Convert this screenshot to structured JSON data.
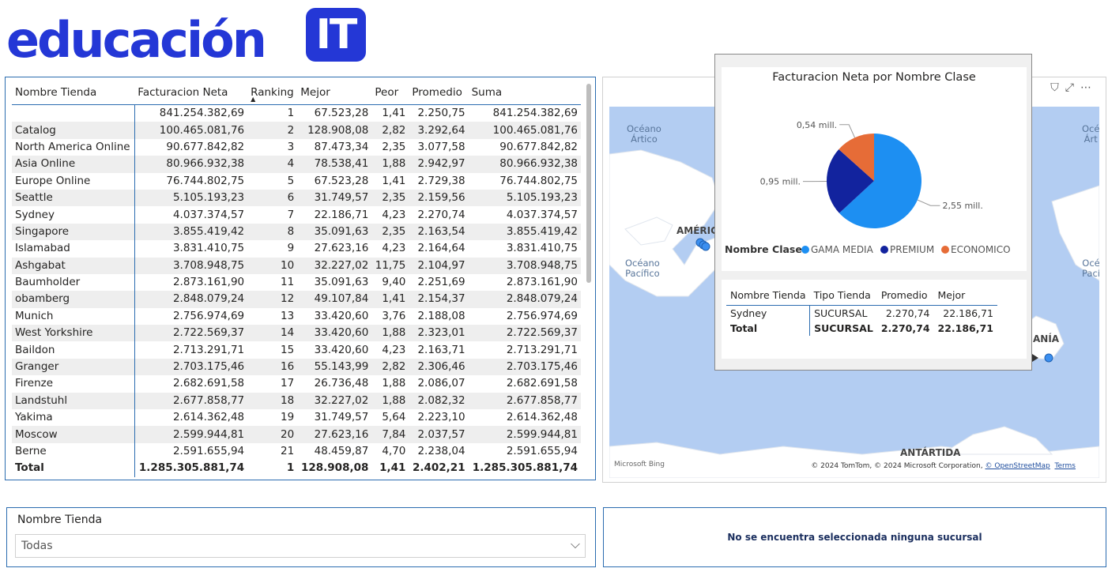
{
  "colors": {
    "brand_blue": "#2437d6",
    "gama_media": "#1d8ff2",
    "premium": "#12239e",
    "economico": "#e66c37"
  },
  "logo": {
    "text": "educación",
    "badge": "IT"
  },
  "table": {
    "headers": [
      "Nombre Tienda",
      "Facturacion Neta",
      "Ranking",
      "Mejor",
      "Peor",
      "Promedio",
      "Suma"
    ],
    "rows": [
      [
        "",
        "841.254.382,69",
        "1",
        "67.523,28",
        "1,41",
        "2.250,75",
        "841.254.382,69"
      ],
      [
        "Catalog",
        "100.465.081,76",
        "2",
        "128.908,08",
        "2,82",
        "3.292,64",
        "100.465.081,76"
      ],
      [
        "North America Online",
        "90.677.842,82",
        "3",
        "87.473,34",
        "2,35",
        "3.077,58",
        "90.677.842,82"
      ],
      [
        "Asia Online",
        "80.966.932,38",
        "4",
        "78.538,41",
        "1,88",
        "2.942,97",
        "80.966.932,38"
      ],
      [
        "Europe Online",
        "76.744.802,75",
        "5",
        "67.523,28",
        "1,41",
        "2.729,38",
        "76.744.802,75"
      ],
      [
        "Seattle",
        "5.105.193,23",
        "6",
        "31.749,57",
        "2,35",
        "2.159,56",
        "5.105.193,23"
      ],
      [
        "Sydney",
        "4.037.374,57",
        "7",
        "22.186,71",
        "4,23",
        "2.270,74",
        "4.037.374,57"
      ],
      [
        "Singapore",
        "3.855.419,42",
        "8",
        "35.091,63",
        "2,35",
        "2.163,54",
        "3.855.419,42"
      ],
      [
        "Islamabad",
        "3.831.410,75",
        "9",
        "27.623,16",
        "4,23",
        "2.164,64",
        "3.831.410,75"
      ],
      [
        "Ashgabat",
        "3.708.948,75",
        "10",
        "32.227,02",
        "11,75",
        "2.104,97",
        "3.708.948,75"
      ],
      [
        "Baumholder",
        "2.873.161,90",
        "11",
        "35.091,63",
        "9,40",
        "2.251,69",
        "2.873.161,90"
      ],
      [
        "obamberg",
        "2.848.079,24",
        "12",
        "49.107,84",
        "1,41",
        "2.154,37",
        "2.848.079,24"
      ],
      [
        "Munich",
        "2.756.974,69",
        "13",
        "33.420,60",
        "3,76",
        "2.188,08",
        "2.756.974,69"
      ],
      [
        "West Yorkshire",
        "2.722.569,37",
        "14",
        "33.420,60",
        "1,88",
        "2.323,01",
        "2.722.569,37"
      ],
      [
        "Baildon",
        "2.713.291,71",
        "15",
        "33.420,60",
        "4,23",
        "2.163,71",
        "2.713.291,71"
      ],
      [
        "Granger",
        "2.703.175,46",
        "16",
        "55.143,99",
        "2,82",
        "2.306,46",
        "2.703.175,46"
      ],
      [
        "Firenze",
        "2.682.691,58",
        "17",
        "26.736,48",
        "1,88",
        "2.086,07",
        "2.682.691,58"
      ],
      [
        "Landstuhl",
        "2.677.858,77",
        "18",
        "32.227,02",
        "1,88",
        "2.082,32",
        "2.677.858,77"
      ],
      [
        "Yakima",
        "2.614.362,48",
        "19",
        "31.749,57",
        "5,64",
        "2.223,10",
        "2.614.362,48"
      ],
      [
        "Moscow",
        "2.599.944,81",
        "20",
        "27.623,16",
        "7,84",
        "2.037,57",
        "2.599.944,81"
      ],
      [
        "Berne",
        "2.591.655,94",
        "21",
        "48.459,87",
        "4,70",
        "2.238,04",
        "2.591.655,94"
      ]
    ],
    "total": [
      "Total",
      "1.285.305.881,74",
      "1",
      "128.908,08",
      "1,41",
      "2.402,21",
      "1.285.305.881,74"
    ]
  },
  "map": {
    "oceans": [
      "Océano\nÁrtico",
      "Océano\nPacífico",
      "Océ\nÁrt",
      "Océ\nPací"
    ],
    "continents": [
      "AMÉRIC",
      "ANTÁRTIDA",
      "ANÍA"
    ],
    "credits": "© 2024 TomTom, © 2024 Microsoft Corporation,",
    "credits_link": "© OpenStreetMap",
    "terms": "Terms",
    "bing": "Microsoft Bing"
  },
  "tooltip": {
    "chart_title": "Facturacion Neta por Nombre Clase",
    "legend_title": "Nombre Clase",
    "table_headers": [
      "Nombre Tienda",
      "Tipo Tienda",
      "Promedio",
      "Mejor"
    ],
    "table_row": [
      "Sydney",
      "SUCURSAL",
      "2.270,74",
      "22.186,71"
    ],
    "table_total": [
      "Total",
      "SUCURSAL",
      "2.270,74",
      "22.186,71"
    ]
  },
  "chart_data": {
    "type": "pie",
    "title": "Facturacion Neta por Nombre Clase",
    "categories": [
      "GAMA MEDIA",
      "PREMIUM",
      "ECONOMICO"
    ],
    "values": [
      2.55,
      0.95,
      0.54
    ],
    "data_labels": [
      "2,55 mill.",
      "0,95 mill.",
      "0,54 mill."
    ],
    "legend_title": "Nombre Clase",
    "legend_position": "bottom"
  },
  "slicer": {
    "title": "Nombre Tienda",
    "value": "Todas"
  },
  "message": "No se encuentra seleccionada ninguna sucursal"
}
